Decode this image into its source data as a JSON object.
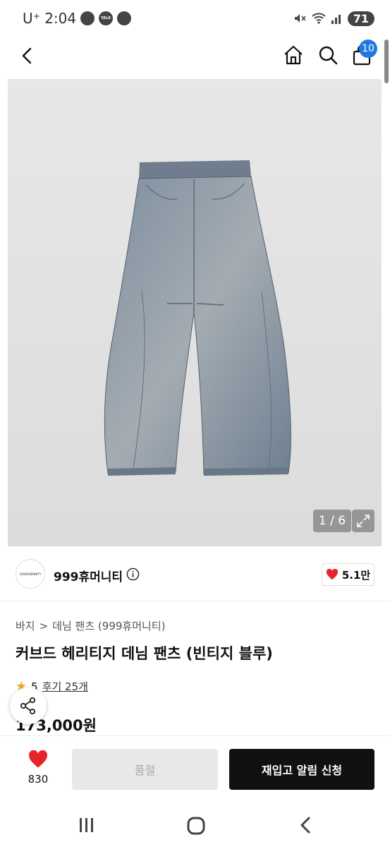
{
  "status_bar": {
    "carrier": "U⁺",
    "time": "2:04",
    "battery": "71"
  },
  "nav": {
    "cart_count": "10"
  },
  "gallery": {
    "counter": "1 / 6"
  },
  "brand": {
    "logo_text": "OOOHUMANITY",
    "name": "999휴머니티",
    "likes": "5.1만"
  },
  "product": {
    "breadcrumb": [
      "바지",
      "데님 팬츠 (999휴머니티)"
    ],
    "breadcrumb_sep": ">",
    "title": "커브드 헤리티지 데님 팬츠 (빈티지 블루)",
    "rating": "5",
    "reviews": "후기 25개",
    "price": "173,000원"
  },
  "actions": {
    "wish_count": "830",
    "soldout_label": "품절",
    "restock_label": "재입고 알림 신청"
  },
  "colors": {
    "accent": "#1f7ae0",
    "heart": "#e8242b",
    "primary_button": "#111111",
    "star": "#f5a623"
  }
}
